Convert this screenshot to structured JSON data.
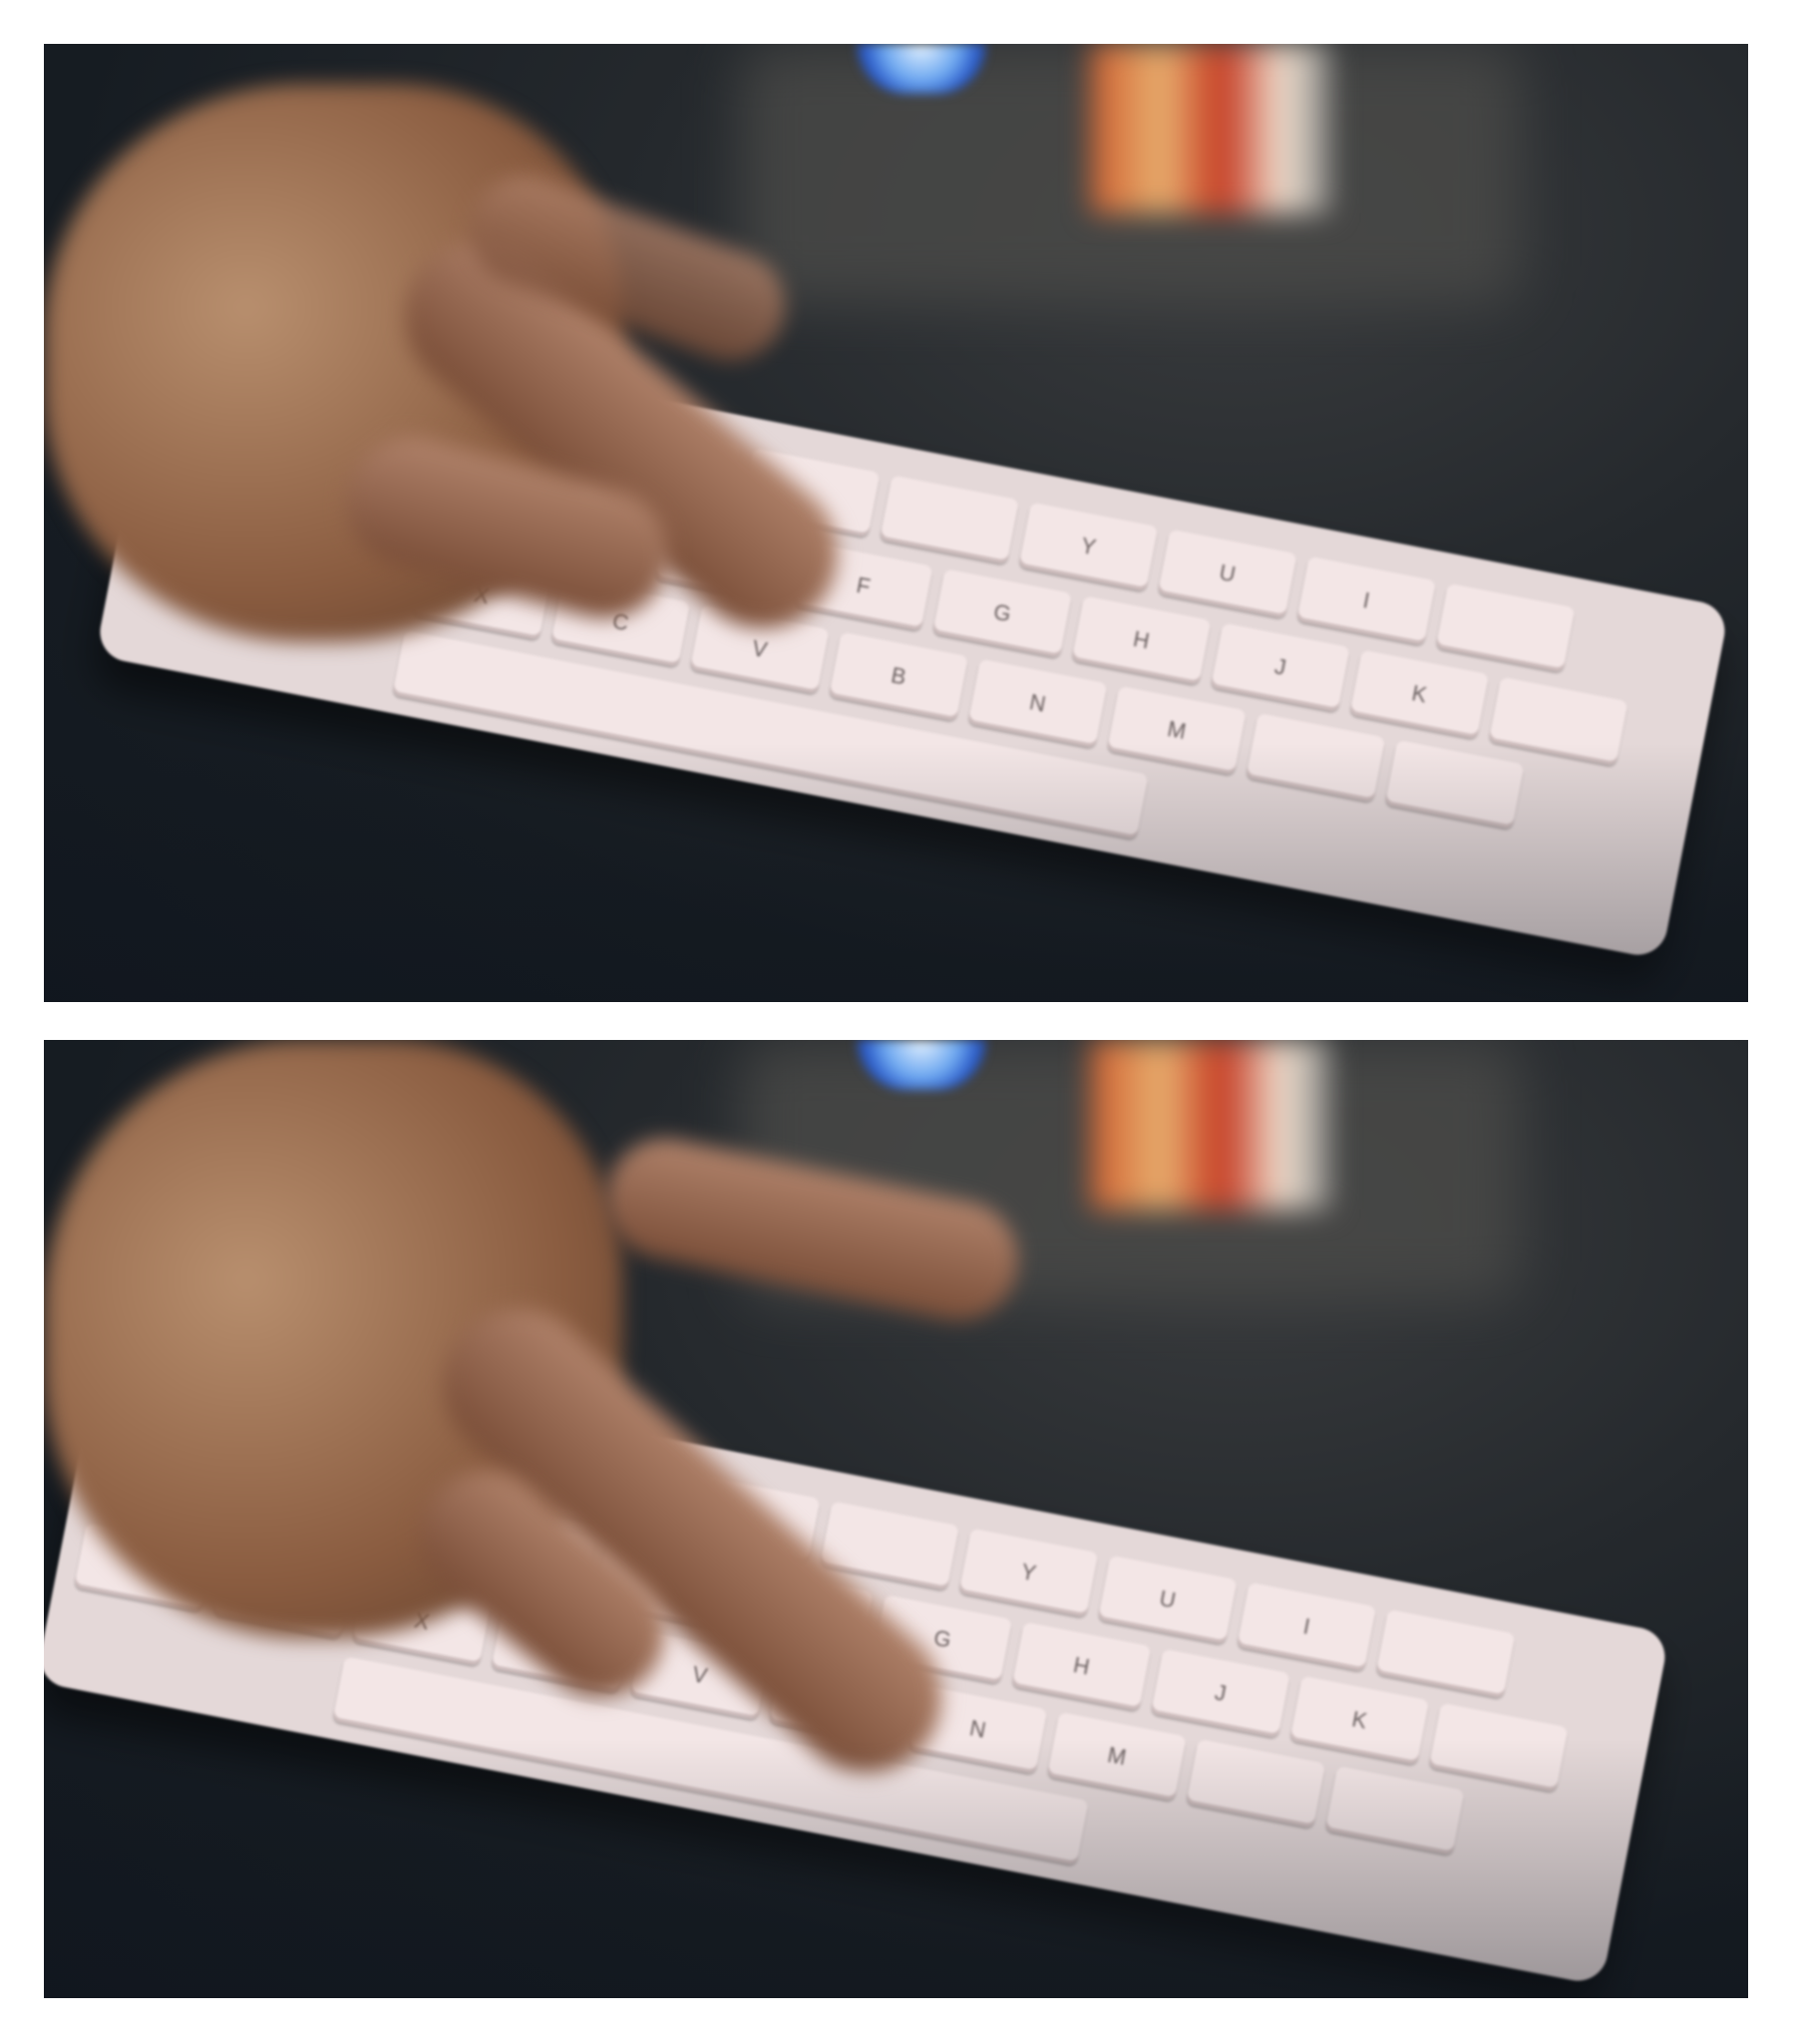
{
  "panels": [
    {
      "id": "top-photo"
    },
    {
      "id": "bottom-photo"
    }
  ],
  "keyboard": {
    "rows": [
      [
        "",
        "",
        "",
        "",
        "",
        "",
        "Y",
        "U",
        "I",
        ""
      ],
      [
        "",
        "",
        "",
        "",
        "F",
        "G",
        "H",
        "J",
        "K",
        ""
      ],
      [
        "",
        "",
        "X",
        "C",
        "V",
        "B",
        "N",
        "M",
        "",
        ""
      ]
    ]
  },
  "colors": {
    "keycap": "#f3e6e6",
    "background": "#161c22",
    "skin": "#a87a5e",
    "light": "#6ea8f0"
  }
}
